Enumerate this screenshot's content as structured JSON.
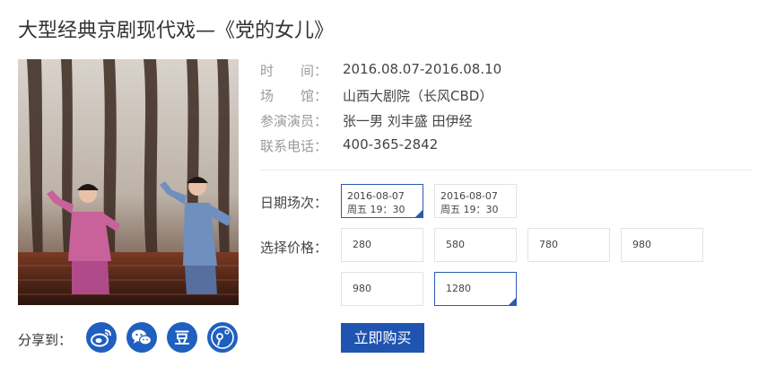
{
  "title": "大型经典京剧现代戏—《党的女儿》",
  "info": {
    "time_label": "时　　间：",
    "time_value": "2016.08.07-2016.08.10",
    "venue_label": "场　　馆：",
    "venue_value": "山西大剧院（长风CBD）",
    "cast_label": "参演演员：",
    "cast_value": "张一男 刘丰盛 田伊经",
    "phone_label": "联系电话：",
    "phone_value": "400-365-2842"
  },
  "schedule": {
    "label": "日期场次：",
    "options": [
      {
        "date": "2016-08-07",
        "time": "周五 19：30",
        "selected": true
      },
      {
        "date": "2016-08-07",
        "time": "周五 19：30",
        "selected": false
      }
    ]
  },
  "price": {
    "label": "选择价格：",
    "options": [
      {
        "value": "280",
        "selected": false
      },
      {
        "value": "580",
        "selected": false
      },
      {
        "value": "780",
        "selected": false
      },
      {
        "value": "980",
        "selected": false
      },
      {
        "value": "980",
        "selected": false
      },
      {
        "value": "1280",
        "selected": true
      }
    ]
  },
  "buy_label": "立即购买",
  "share": {
    "label": "分享到：",
    "icons": [
      "weibo-icon",
      "wechat-icon",
      "douban-icon",
      "qzone-icon"
    ],
    "douban_glyph": "豆"
  },
  "colors": {
    "accent": "#1f54b0",
    "selected_border": "#2b5ab4"
  }
}
